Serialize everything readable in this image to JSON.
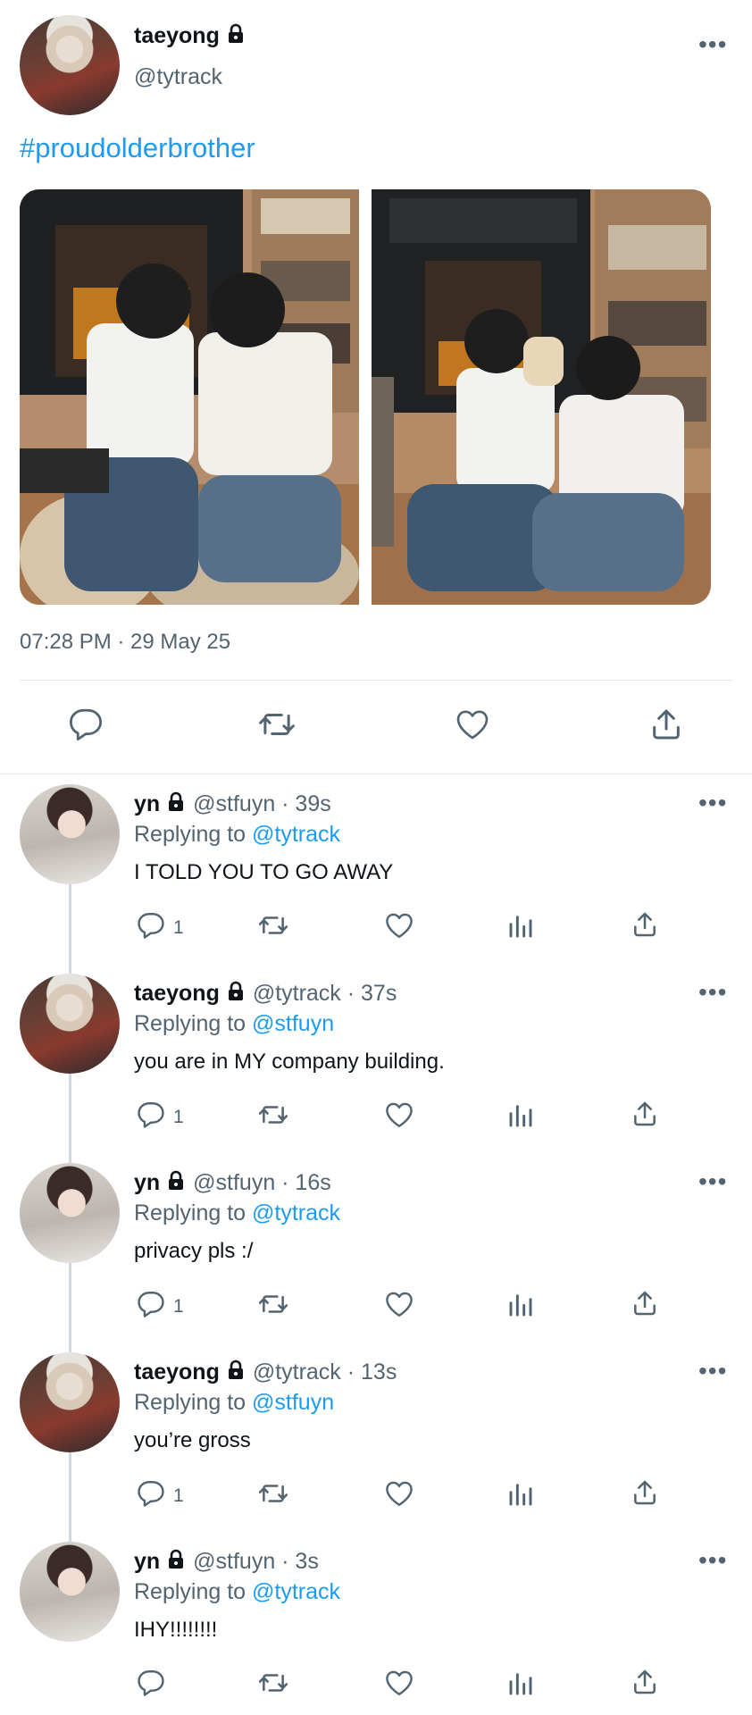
{
  "tweet": {
    "name": "taeyong",
    "handle": "@tytrack",
    "text": "#proudolderbrother",
    "timestamp": "07:28 PM · 29 May 25"
  },
  "replies": [
    {
      "name": "yn",
      "handle_time": "@stfuyn · 39s",
      "replying_prefix": "Replying to ",
      "replying_to": "@tytrack",
      "text": "I TOLD YOU TO GO AWAY",
      "reply_count": "1"
    },
    {
      "name": "taeyong",
      "handle_time": "@tytrack · 37s",
      "replying_prefix": "Replying to ",
      "replying_to": "@stfuyn",
      "text": "you are in MY company building.",
      "reply_count": "1"
    },
    {
      "name": "yn",
      "handle_time": "@stfuyn · 16s",
      "replying_prefix": "Replying to ",
      "replying_to": "@tytrack",
      "text": "privacy pls :/",
      "reply_count": "1"
    },
    {
      "name": "taeyong",
      "handle_time": "@tytrack · 13s",
      "replying_prefix": "Replying to ",
      "replying_to": "@stfuyn",
      "text": "you’re gross",
      "reply_count": "1"
    },
    {
      "name": "yn",
      "handle_time": "@stfuyn · 3s",
      "replying_prefix": "Replying to ",
      "replying_to": "@tytrack",
      "text": "IHY!!!!!!!!",
      "reply_count": ""
    }
  ],
  "icons": {
    "more": "more-icon",
    "lock": "lock-icon",
    "reply": "reply-icon",
    "retweet": "retweet-icon",
    "like": "like-icon",
    "views": "views-icon",
    "share": "share-icon"
  },
  "colors": {
    "link": "#1d9bf0",
    "muted": "#536471",
    "text": "#0f1419",
    "divider": "#e1e6ea"
  }
}
